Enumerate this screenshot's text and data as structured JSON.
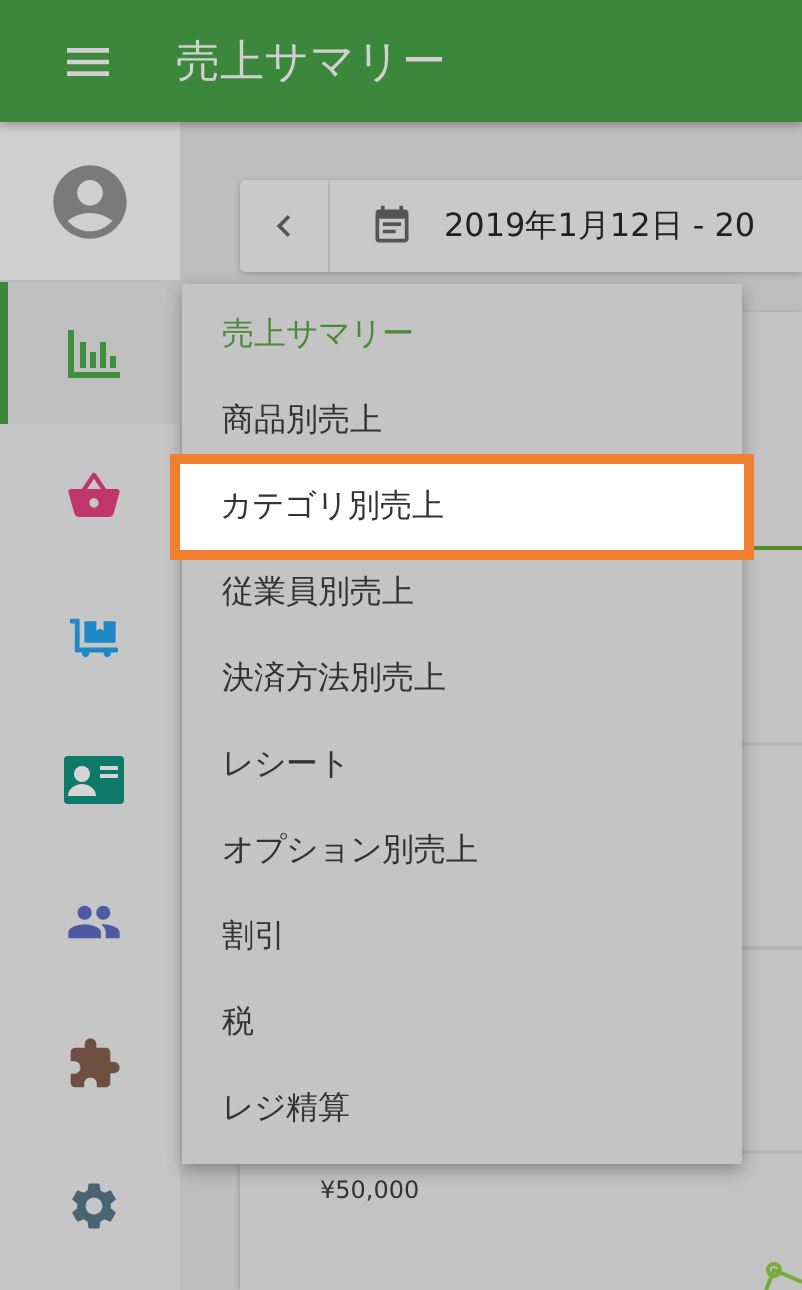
{
  "header": {
    "title": "売上サマリー"
  },
  "sidebar": {
    "items": [
      {
        "selected": true,
        "color": "#3e8e3e"
      },
      {
        "selected": false,
        "color": "#c0356a"
      },
      {
        "selected": false,
        "color": "#1f88c6"
      },
      {
        "selected": false,
        "color": "#0e7a6a"
      },
      {
        "selected": false,
        "color": "#4f5aa6"
      },
      {
        "selected": false,
        "color": "#704f43"
      },
      {
        "selected": false,
        "color": "#4a6471"
      }
    ]
  },
  "date_bar": {
    "range": "2019年1月12日 - 20"
  },
  "card": {
    "axis_label": "¥50,000"
  },
  "menu": {
    "items": [
      {
        "label": "売上サマリー",
        "selected": true,
        "highlighted": false
      },
      {
        "label": "商品別売上",
        "selected": false,
        "highlighted": false
      },
      {
        "label": "カテゴリ別売上",
        "selected": false,
        "highlighted": true
      },
      {
        "label": "従業員別売上",
        "selected": false,
        "highlighted": false
      },
      {
        "label": "決済方法別売上",
        "selected": false,
        "highlighted": false
      },
      {
        "label": "レシート",
        "selected": false,
        "highlighted": false
      },
      {
        "label": "オプション別売上",
        "selected": false,
        "highlighted": false
      },
      {
        "label": "割引",
        "selected": false,
        "highlighted": false
      },
      {
        "label": "税",
        "selected": false,
        "highlighted": false
      },
      {
        "label": "レジ精算",
        "selected": false,
        "highlighted": false
      }
    ]
  }
}
